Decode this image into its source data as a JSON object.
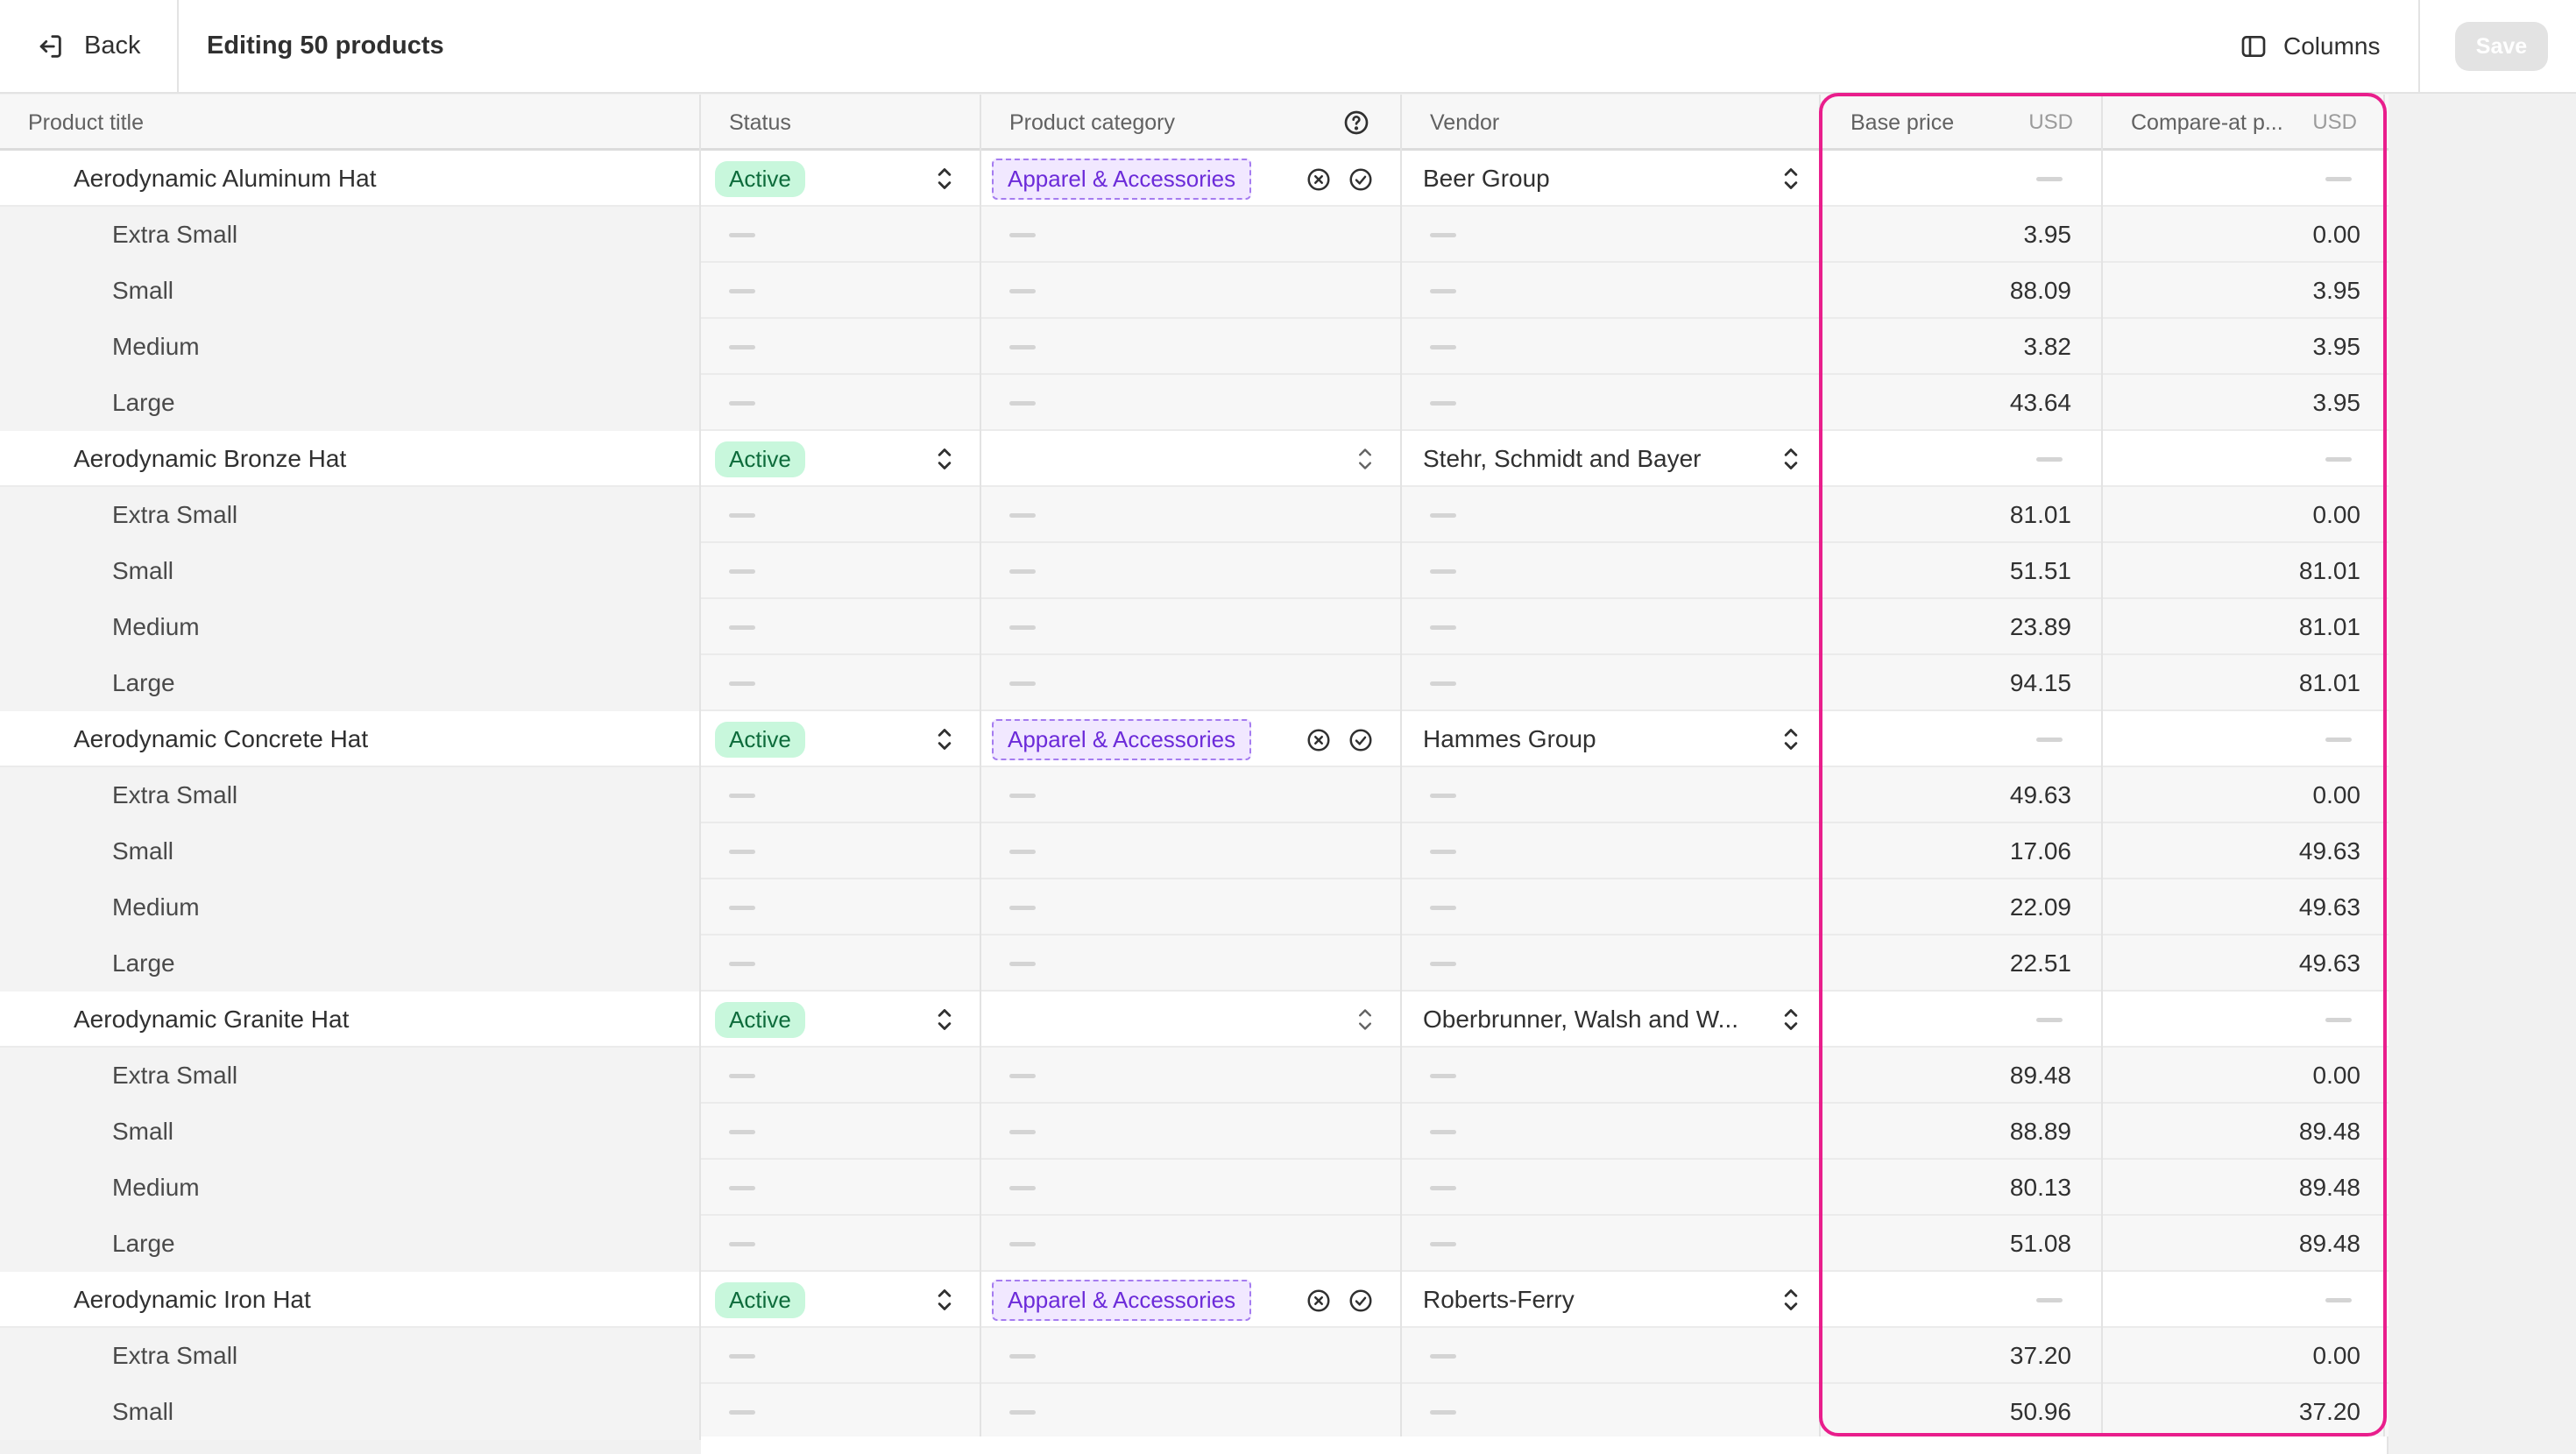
{
  "topbar": {
    "back_label": "Back",
    "title": "Editing 50 products",
    "columns_label": "Columns",
    "save_label": "Save"
  },
  "columns": {
    "product_title": "Product title",
    "status": "Status",
    "product_category": "Product category",
    "vendor": "Vendor",
    "base_price": "Base price",
    "base_price_currency": "USD",
    "compare_at": "Compare-at p...",
    "compare_at_currency": "USD"
  },
  "colors": {
    "highlight": "#e91e8c",
    "active_badge_bg": "#c8f7dc",
    "category_tag_bg": "#f1e8ff"
  },
  "rows": [
    {
      "type": "parent",
      "title": "Aerodynamic Aluminum Hat",
      "status": "Active",
      "category": "Apparel & Accessories",
      "vendor": "Beer Group"
    },
    {
      "type": "variant",
      "title": "Extra Small",
      "base": "3.95",
      "compare": "0.00"
    },
    {
      "type": "variant",
      "title": "Small",
      "base": "88.09",
      "compare": "3.95"
    },
    {
      "type": "variant",
      "title": "Medium",
      "base": "3.82",
      "compare": "3.95"
    },
    {
      "type": "variant",
      "title": "Large",
      "base": "43.64",
      "compare": "3.95"
    },
    {
      "type": "parent",
      "title": "Aerodynamic Bronze Hat",
      "status": "Active",
      "category": "",
      "vendor": "Stehr, Schmidt and Bayer"
    },
    {
      "type": "variant",
      "title": "Extra Small",
      "base": "81.01",
      "compare": "0.00"
    },
    {
      "type": "variant",
      "title": "Small",
      "base": "51.51",
      "compare": "81.01"
    },
    {
      "type": "variant",
      "title": "Medium",
      "base": "23.89",
      "compare": "81.01"
    },
    {
      "type": "variant",
      "title": "Large",
      "base": "94.15",
      "compare": "81.01"
    },
    {
      "type": "parent",
      "title": "Aerodynamic Concrete Hat",
      "status": "Active",
      "category": "Apparel & Accessories",
      "vendor": "Hammes Group"
    },
    {
      "type": "variant",
      "title": "Extra Small",
      "base": "49.63",
      "compare": "0.00"
    },
    {
      "type": "variant",
      "title": "Small",
      "base": "17.06",
      "compare": "49.63"
    },
    {
      "type": "variant",
      "title": "Medium",
      "base": "22.09",
      "compare": "49.63"
    },
    {
      "type": "variant",
      "title": "Large",
      "base": "22.51",
      "compare": "49.63"
    },
    {
      "type": "parent",
      "title": "Aerodynamic Granite Hat",
      "status": "Active",
      "category": "",
      "vendor": "Oberbrunner, Walsh and W..."
    },
    {
      "type": "variant",
      "title": "Extra Small",
      "base": "89.48",
      "compare": "0.00"
    },
    {
      "type": "variant",
      "title": "Small",
      "base": "88.89",
      "compare": "89.48"
    },
    {
      "type": "variant",
      "title": "Medium",
      "base": "80.13",
      "compare": "89.48"
    },
    {
      "type": "variant",
      "title": "Large",
      "base": "51.08",
      "compare": "89.48"
    },
    {
      "type": "parent",
      "title": "Aerodynamic Iron Hat",
      "status": "Active",
      "category": "Apparel & Accessories",
      "vendor": "Roberts-Ferry"
    },
    {
      "type": "variant",
      "title": "Extra Small",
      "base": "37.20",
      "compare": "0.00"
    },
    {
      "type": "variant",
      "title": "Small",
      "base": "50.96",
      "compare": "37.20"
    }
  ]
}
